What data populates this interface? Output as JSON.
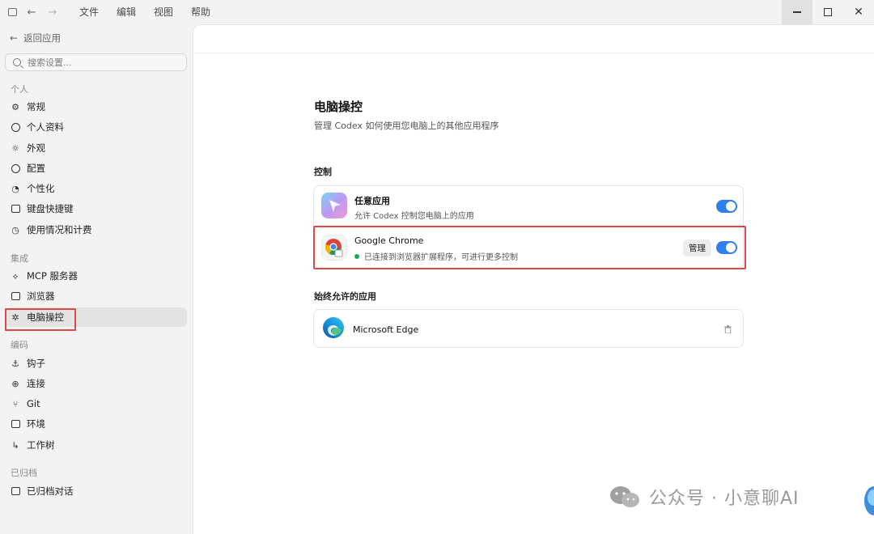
{
  "menu": [
    "文件",
    "编辑",
    "视图",
    "帮助"
  ],
  "sidebar": {
    "back_label": "返回应用",
    "search_placeholder": "搜索设置...",
    "sections": {
      "personal": "个人",
      "integration": "集成",
      "coding": "编码",
      "archived": "已归档"
    },
    "items": {
      "general": "常规",
      "profile": "个人资料",
      "appearance": "外观",
      "config": "配置",
      "personalization": "个性化",
      "shortcuts": "键盘快捷键",
      "usage": "使用情况和计费",
      "mcp": "MCP 服务器",
      "browser": "浏览器",
      "computer_use": "电脑操控",
      "hooks": "钩子",
      "connections": "连接",
      "git": "Git",
      "environment": "环境",
      "worktree": "工作树",
      "archived_chats": "已归档对话"
    }
  },
  "main": {
    "title": "电脑操控",
    "subtitle": "管理 Codex 如何使用您电脑上的其他应用程序",
    "control_label": "控制",
    "any_app": {
      "title": "任意应用",
      "desc": "允许 Codex 控制您电脑上的应用",
      "enabled": true
    },
    "chrome": {
      "title": "Google Chrome",
      "desc": "已连接到浏览器扩展程序，可进行更多控制",
      "manage_label": "管理",
      "enabled": true
    },
    "always_allowed_label": "始终允许的应用",
    "edge": {
      "title": "Microsoft Edge"
    }
  },
  "watermark": "公众号 · 小意聊AI",
  "colors": {
    "toggle": "#2f7ff0",
    "highlight": "#e04848",
    "status_green": "#1fa75a"
  }
}
